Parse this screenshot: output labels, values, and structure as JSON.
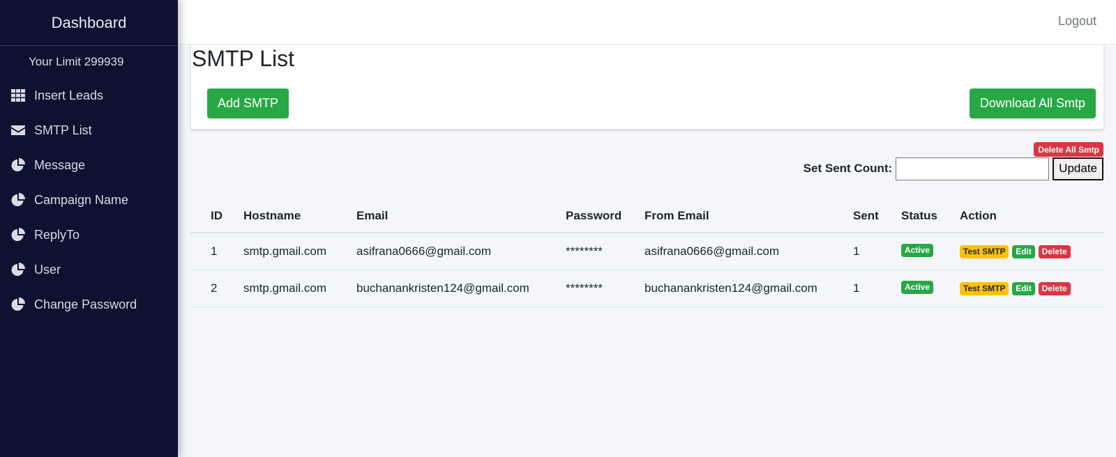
{
  "sidebar": {
    "brand": "Dashboard",
    "limit": "Your Limit 299939",
    "items": [
      {
        "label": "Insert Leads",
        "icon": "grid-icon"
      },
      {
        "label": "SMTP List",
        "icon": "envelope-icon"
      },
      {
        "label": "Message",
        "icon": "pie-chart-icon"
      },
      {
        "label": "Campaign Name",
        "icon": "pie-chart-icon"
      },
      {
        "label": "ReplyTo",
        "icon": "pie-chart-icon"
      },
      {
        "label": "User",
        "icon": "pie-chart-icon"
      },
      {
        "label": "Change Password",
        "icon": "pie-chart-icon"
      }
    ]
  },
  "topbar": {
    "logout": "Logout"
  },
  "page": {
    "title": "SMTP List",
    "add_button": "Add SMTP",
    "download_button": "Download All Smtp",
    "delete_all": "Delete All Smtp",
    "sent_count_label": "Set Sent Count:",
    "sent_count_value": "",
    "update_button": "Update"
  },
  "table": {
    "headers": [
      "ID",
      "Hostname",
      "Email",
      "Password",
      "From Email",
      "Sent",
      "Status",
      "Action"
    ],
    "rows": [
      {
        "id": "1",
        "hostname": "smtp.gmail.com",
        "email": "asifrana0666@gmail.com",
        "password": "********",
        "from_email": "asifrana0666@gmail.com",
        "sent": "1",
        "status": "Active"
      },
      {
        "id": "2",
        "hostname": "smtp.gmail.com",
        "email": "buchanankristen124@gmail.com",
        "password": "********",
        "from_email": "buchanankristen124@gmail.com",
        "sent": "1",
        "status": "Active"
      }
    ],
    "actions": {
      "test": "Test SMTP",
      "edit": "Edit",
      "delete": "Delete"
    }
  },
  "colors": {
    "sidebar_bg": "#0e1130",
    "success": "#28a745",
    "danger": "#dc3545",
    "warning": "#ffc107"
  }
}
